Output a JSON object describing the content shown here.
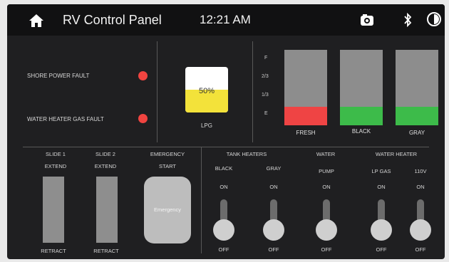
{
  "header": {
    "title": "RV Control Panel",
    "time": "12:21 AM",
    "icons": [
      "home-icon",
      "camera-icon",
      "bluetooth-icon",
      "brightness-icon"
    ]
  },
  "faults": [
    {
      "label": "SHORE POWER FAULT",
      "status": "active"
    },
    {
      "label": "WATER HEATER GAS FAULT",
      "status": "active"
    }
  ],
  "lpg": {
    "label": "LPG",
    "value_text": "50%",
    "level": 0.5
  },
  "tank_scale": [
    "F",
    "2/3",
    "1/3",
    "E"
  ],
  "tanks": [
    {
      "label": "FRESH",
      "level": 0.25,
      "color": "#ef4444"
    },
    {
      "label": "BLACK",
      "level": 0.25,
      "color": "#3dbb4a"
    },
    {
      "label": "GRAY",
      "level": 0.25,
      "color": "#3dbb4a"
    }
  ],
  "slides": [
    {
      "title": "SLIDE 1",
      "top": "EXTEND",
      "bottom": "RETRACT"
    },
    {
      "title": "SLIDE 2",
      "top": "EXTEND",
      "bottom": "RETRACT"
    }
  ],
  "emergency": {
    "title": "EMERGENCY",
    "subtitle": "START",
    "button": "Emergency"
  },
  "sections": {
    "tank_heaters": "TANK HEATERS",
    "water": "WATER",
    "water_heater": "WATER HEATER"
  },
  "toggles": [
    {
      "label": "BLACK",
      "on": "ON",
      "off": "OFF",
      "state": "off"
    },
    {
      "label": "GRAY",
      "on": "ON",
      "off": "OFF",
      "state": "off"
    },
    {
      "label": "PUMP",
      "on": "ON",
      "off": "OFF",
      "state": "off"
    },
    {
      "label": "LP GAS",
      "on": "ON",
      "off": "OFF",
      "state": "off"
    },
    {
      "label": "110V",
      "on": "ON",
      "off": "OFF",
      "state": "off"
    }
  ],
  "colors": {
    "fault": "#f04440",
    "lpg": "#f3e23a",
    "background": "#1f1f21"
  }
}
